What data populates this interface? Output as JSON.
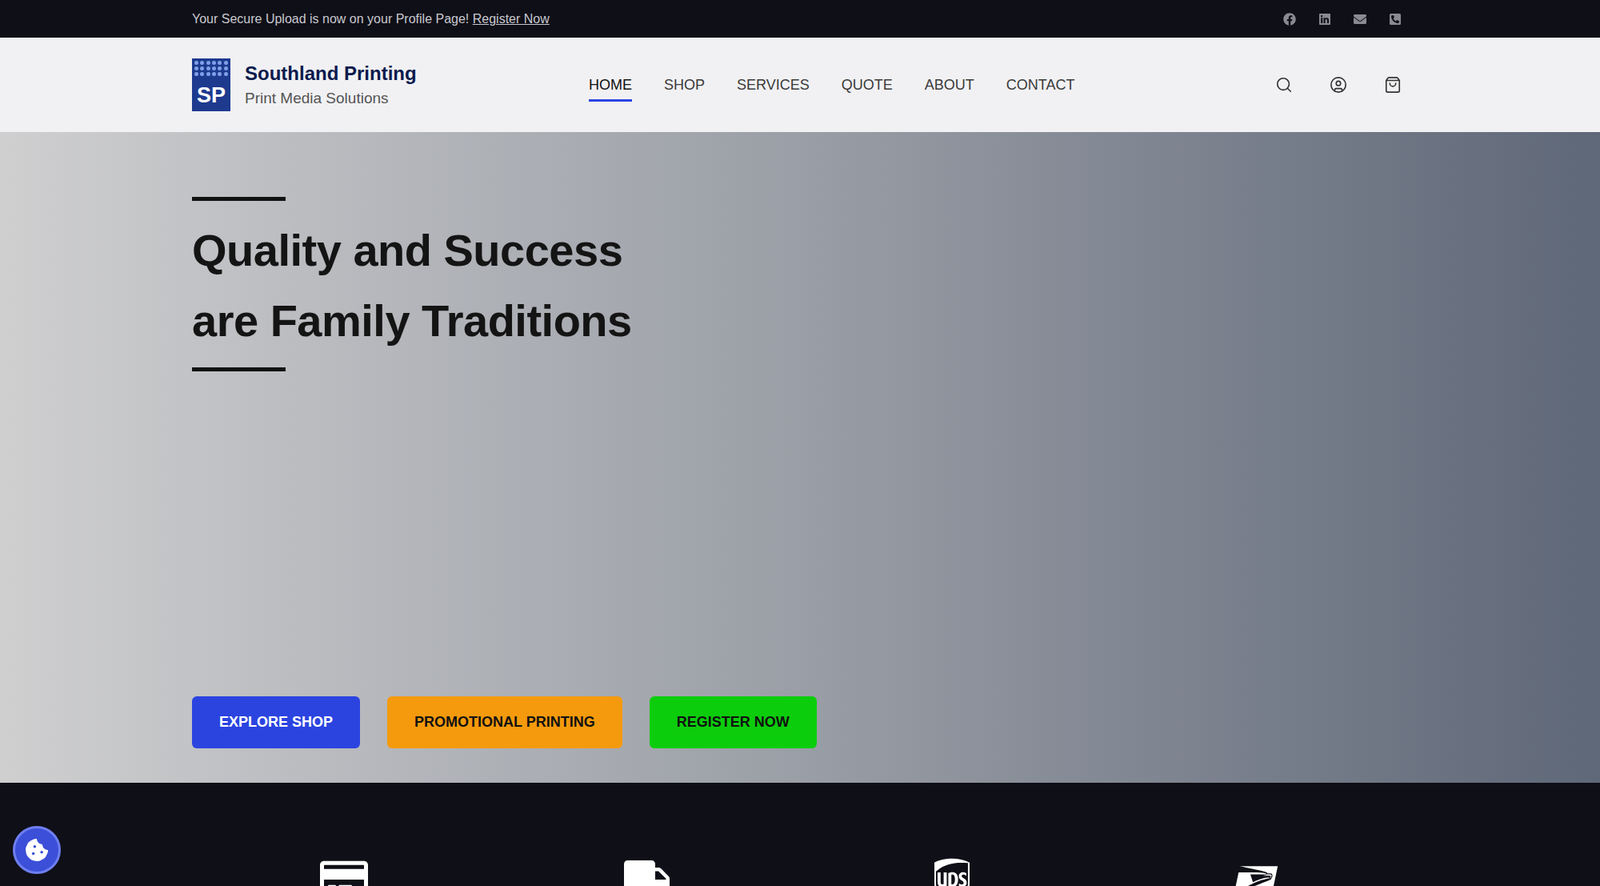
{
  "announcement": {
    "text": "Your Secure Upload is now on your Profile Page!",
    "link": "Register Now"
  },
  "social": [
    {
      "kind": "facebook"
    },
    {
      "kind": "linkedin"
    },
    {
      "kind": "email"
    },
    {
      "kind": "phone"
    }
  ],
  "logo": {
    "mark": "SP",
    "title": "Southland Printing",
    "subtitle": "Print Media Solutions"
  },
  "nav": [
    {
      "label": "HOME",
      "selected": true
    },
    {
      "label": "SHOP",
      "selected": false
    },
    {
      "label": "SERVICES",
      "selected": false
    },
    {
      "label": "QUOTE",
      "selected": false
    },
    {
      "label": "ABOUT",
      "selected": false
    },
    {
      "label": "CONTACT",
      "selected": false
    }
  ],
  "header_actions": [
    {
      "kind": "search"
    },
    {
      "kind": "account"
    },
    {
      "kind": "cart"
    }
  ],
  "hero": {
    "heading": [
      "Quality and Success",
      "are Family Traditions"
    ],
    "buttons": [
      {
        "label": "EXPLORE SHOP",
        "color": "#2b44e0",
        "text_color": "#ffffff"
      },
      {
        "label": "PROMOTIONAL PRINTING",
        "color": "#f59a0c",
        "text_color": "#111111"
      },
      {
        "label": "REGISTER NOW",
        "color": "#0ccd0c",
        "text_color": "#111111"
      }
    ]
  },
  "features": [
    {
      "kind": "payment"
    },
    {
      "kind": "delivery"
    },
    {
      "kind": "ups"
    },
    {
      "kind": "usps"
    }
  ]
}
